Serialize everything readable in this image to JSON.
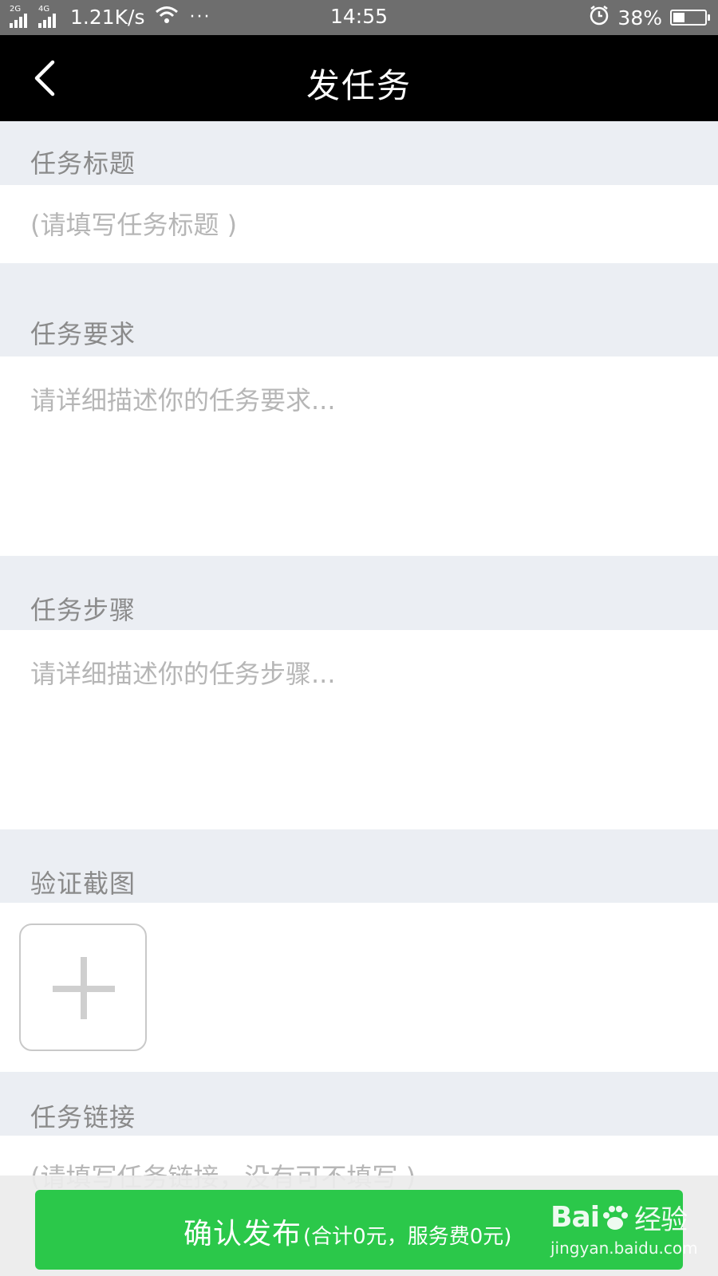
{
  "status_bar": {
    "net1": "2G",
    "net2": "4G",
    "speed": "1.21K/s",
    "dots": "···",
    "time": "14:55",
    "battery_text": "38%",
    "battery_level": 0.38
  },
  "nav": {
    "title": "发任务",
    "back_icon": "chevron-left-icon"
  },
  "form": {
    "title_label": "任务标题",
    "title_placeholder": "(请填写任务标题 )",
    "requirements_label": "任务要求",
    "requirements_placeholder": "请详细描述你的任务要求...",
    "steps_label": "任务步骤",
    "steps_placeholder": "请详细描述你的任务步骤...",
    "screenshot_label": "验证截图",
    "add_image_icon": "plus-icon",
    "link_label": "任务链接",
    "link_placeholder": "(请填写任务链接，没有可不填写 )"
  },
  "footer": {
    "confirm_label": "确认发布",
    "confirm_detail": "(合计0元，服务费0元)",
    "button_color": "#2bc84a"
  },
  "watermark": {
    "logo_left": "Bai",
    "logo_right": "经验",
    "url": "jingyan.baidu.com"
  }
}
